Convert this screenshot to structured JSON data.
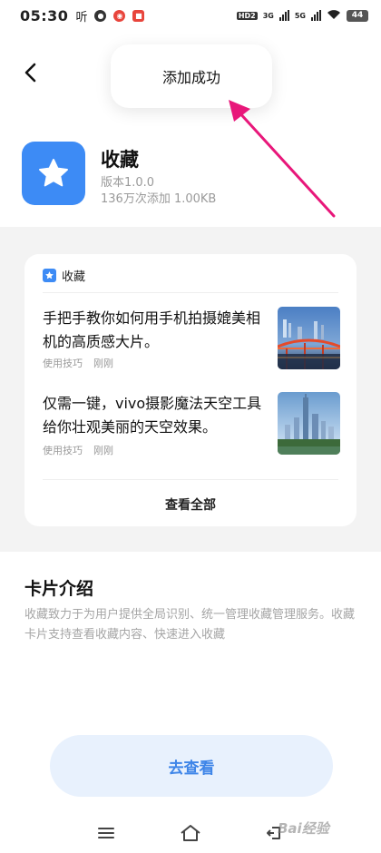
{
  "status_bar": {
    "time": "05:30",
    "app_label": "听",
    "network_badges": [
      "HD2",
      "3G",
      "5G"
    ],
    "battery": "44"
  },
  "toast": {
    "text": "添加成功"
  },
  "app": {
    "name": "收藏",
    "version": "版本1.0.0",
    "meta": "136万次添加 1.00KB",
    "accent_color": "#3d8bf5"
  },
  "card": {
    "header_label": "收藏",
    "items": [
      {
        "title": "手把手教你如何用手机拍摄媲美相机的高质感大片。",
        "category": "使用技巧",
        "time": "刚刚",
        "thumb": "bridge-night-photo"
      },
      {
        "title": "仅需一键，vivo摄影魔法天空工具给你壮观美丽的天空效果。",
        "category": "使用技巧",
        "time": "刚刚",
        "thumb": "city-skyline-photo"
      }
    ],
    "footer_label": "查看全部"
  },
  "intro": {
    "title": "卡片介绍",
    "description": "收藏致力于为用户提供全局识别、统一管理收藏管理服务。收藏卡片支持查看收藏内容、快速进入收藏"
  },
  "cta": {
    "label": "去查看",
    "color": "#3e85e8"
  },
  "watermark": "Bai经验",
  "annotation_color": "#e8177a"
}
